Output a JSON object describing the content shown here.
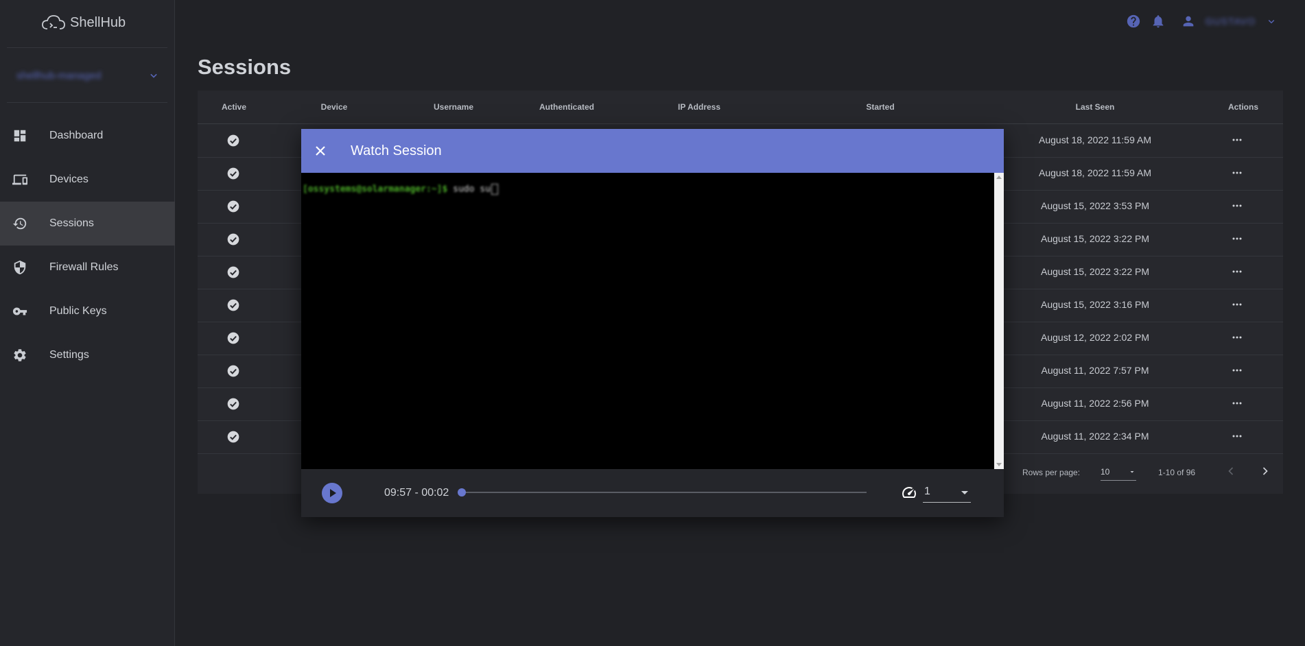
{
  "app": {
    "name": "ShellHub"
  },
  "namespace": {
    "name": "shellhub-managed"
  },
  "sidebar": {
    "items": [
      {
        "label": "Dashboard",
        "icon": "dashboard-icon",
        "active": false
      },
      {
        "label": "Devices",
        "icon": "devices-icon",
        "active": false
      },
      {
        "label": "Sessions",
        "icon": "history-icon",
        "active": true
      },
      {
        "label": "Firewall Rules",
        "icon": "shield-icon",
        "active": false
      },
      {
        "label": "Public Keys",
        "icon": "key-icon",
        "active": false
      },
      {
        "label": "Settings",
        "icon": "gear-icon",
        "active": false
      }
    ]
  },
  "topbar": {
    "user_name": "GUSTAVO"
  },
  "page": {
    "title": "Sessions"
  },
  "table": {
    "headers": [
      "Active",
      "Device",
      "Username",
      "Authenticated",
      "IP Address",
      "Started",
      "Last Seen",
      "Actions"
    ],
    "rows": [
      {
        "last_seen": "August 18, 2022 11:59 AM"
      },
      {
        "last_seen": "August 18, 2022 11:59 AM"
      },
      {
        "last_seen": "August 15, 2022 3:53 PM"
      },
      {
        "last_seen": "August 15, 2022 3:22 PM"
      },
      {
        "last_seen": "August 15, 2022 3:22 PM"
      },
      {
        "last_seen": "August 15, 2022 3:16 PM"
      },
      {
        "last_seen": "August 12, 2022 2:02 PM"
      },
      {
        "last_seen": "August 11, 2022 7:57 PM"
      },
      {
        "last_seen": "August 11, 2022 2:56 PM"
      },
      {
        "last_seen": "August 11, 2022 2:34 PM"
      }
    ],
    "footer": {
      "rows_per_page_label": "Rows per page:",
      "rows_per_page": "10",
      "range": "1-10 of 96"
    }
  },
  "modal": {
    "title": "Watch Session",
    "terminal": {
      "prompt": "[ossystems@solarmanager:~]$",
      "command": "sudo su"
    },
    "player": {
      "time": "09:57 - 00:02",
      "progress": 0.0,
      "speed": "1"
    }
  },
  "colors": {
    "accent": "#6877ce",
    "background": "#212226",
    "sidebar": "#25262b",
    "active_item": "#3a3b40"
  }
}
